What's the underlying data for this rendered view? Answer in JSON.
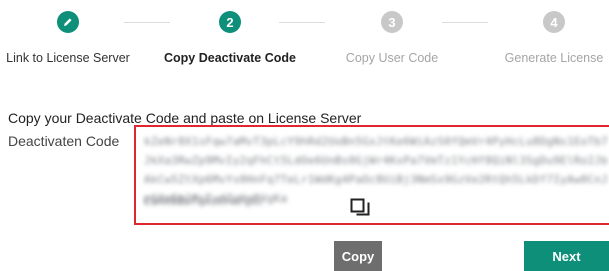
{
  "steps": [
    {
      "number": "",
      "label": "Link to License Server",
      "status": "done",
      "icon": "pencil-icon"
    },
    {
      "number": "2",
      "label": "Copy Deactivate Code",
      "status": "active"
    },
    {
      "number": "3",
      "label": "Copy User Code",
      "status": "pending"
    },
    {
      "number": "4",
      "label": "Generate License",
      "status": "pending"
    }
  ],
  "main": {
    "instruction": "Copy your Deactivate Code and paste on License Server",
    "field_label": "Deactivaten Code",
    "code_value": "kZeNr8X1sFqw7aMvT3pLcY9hRd2UoBn5GxJtKe6WiAzS0fQmVr4PyHcLu8DgNs1EoTb7JkXa3RwZp9MvIy2qFhCt5LdOe6UnBs0GjWr4KxPa7VmTz1YcHf8QiNl3SgDu9ElRo2JbAkCw5ZtXp6MvYs0HnFq7TeLr1WdKg4PaOc8UiBj3NmSx9GzVe2RtQh5LkDf7IyAw0CnJp6XoEb1MsTu4ZqHr8VgKa",
    "code_tail": "CaHX0BbfqAskFmrqKc",
    "copy_icon": "copy-icon"
  },
  "actions": {
    "copy_label": "Copy",
    "next_label": "Next"
  },
  "colors": {
    "primary": "#0d8f79",
    "error_border": "#e0262f",
    "secondary_button": "#6e6e6e"
  }
}
